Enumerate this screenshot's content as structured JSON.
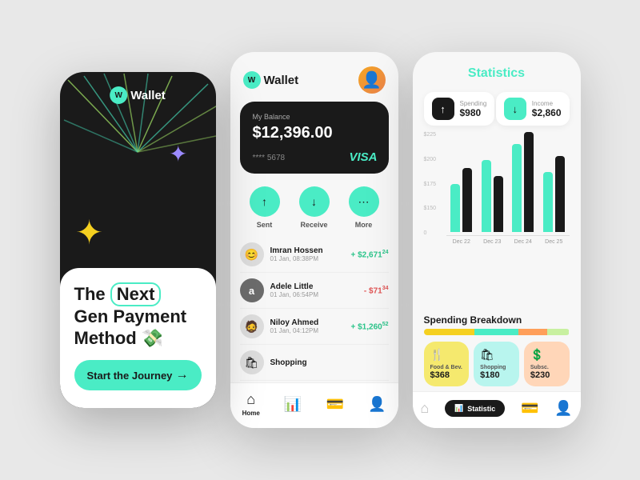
{
  "screen1": {
    "logo": "Wallet",
    "logo_w": "W",
    "title_line1": "The",
    "title_next": "Next",
    "title_line2": "Gen Payment",
    "title_line3": "Method 💸",
    "cta": "Start the Journey",
    "colors": {
      "bg": "#1a1a1a",
      "accent": "#4aecc5",
      "star1": "#9b8aff",
      "star2": "#f5d020"
    }
  },
  "screen2": {
    "logo": "Wallet",
    "logo_w": "W",
    "card": {
      "label": "My Balance",
      "balance": "$12,396.00",
      "number": "**** 5678",
      "brand": "VISA"
    },
    "actions": [
      "Sent",
      "Receive",
      "More"
    ],
    "transactions": [
      {
        "name": "Imran Hossen",
        "date": "01 Jan, 08:38PM",
        "amount": "+ $2,671",
        "cents": "24",
        "type": "positive",
        "emoji": "😊"
      },
      {
        "name": "Adele Little",
        "date": "01 Jan, 06:54PM",
        "amount": "- $71",
        "cents": "34",
        "type": "negative",
        "letter": "a"
      },
      {
        "name": "Niloy Ahmed",
        "date": "01 Jan, 04:12PM",
        "amount": "+ $1,260",
        "cents": "52",
        "type": "positive",
        "emoji": "🧔"
      },
      {
        "name": "Shopping",
        "date": "",
        "amount": "",
        "cents": "",
        "type": "",
        "emoji": "🛍"
      }
    ],
    "nav": [
      "Home",
      "",
      "",
      ""
    ]
  },
  "screen3": {
    "title": "Statistics",
    "spending": {
      "label": "Spending",
      "value": "$980",
      "direction": "↑"
    },
    "income": {
      "label": "Income",
      "value": "$2,860",
      "direction": "↓"
    },
    "chart": {
      "y_labels": [
        "$225",
        "$200",
        "$175",
        "$150",
        "0"
      ],
      "bars": [
        {
          "cyan": 60,
          "dark": 80,
          "label": "Dec 22"
        },
        {
          "cyan": 90,
          "dark": 70,
          "label": "Dec 23"
        },
        {
          "cyan": 110,
          "dark": 120,
          "label": "Dec 24"
        },
        {
          "cyan": 75,
          "dark": 95,
          "label": "Dec 25"
        }
      ]
    },
    "breakdown_title": "Spending Breakdown",
    "breakdown_segments": [
      35,
      30,
      20,
      15
    ],
    "categories": [
      {
        "icon": "🍴",
        "name": "Food & Bev.",
        "amount": "$368",
        "color": "yellow"
      },
      {
        "icon": "🛍",
        "name": "Shopping",
        "amount": "$180",
        "color": "cyan"
      },
      {
        "icon": "$",
        "name": "Subsc.",
        "amount": "$230",
        "color": "orange"
      }
    ],
    "nav_active": "Statistic"
  }
}
